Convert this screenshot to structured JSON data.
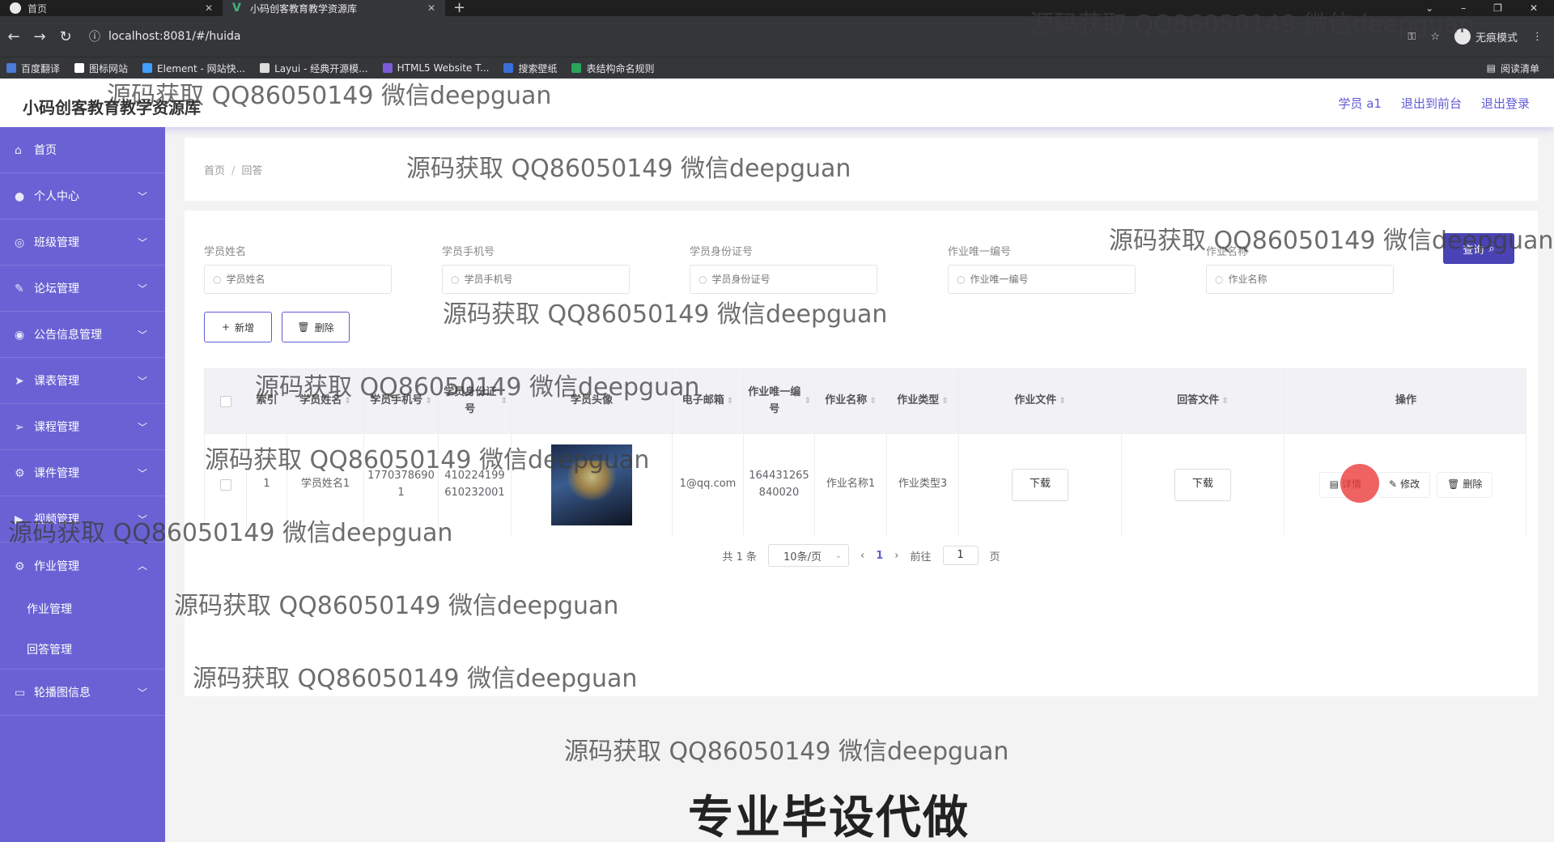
{
  "browser": {
    "tabs": [
      {
        "label": "首页",
        "active": false
      },
      {
        "label": "小码创客教育教学资源库",
        "active": true
      }
    ],
    "url": "localhost:8081/#/huida",
    "incognito_label": "无痕模式",
    "bookmarks": [
      "百度翻译",
      "图标网站",
      "Element - 网站快...",
      "Layui - 经典开源模...",
      "HTML5 Website T...",
      "搜索壁纸",
      "表结构命名规则"
    ],
    "reading_list": "阅读清单"
  },
  "header": {
    "title": "小码创客教育教学资源库",
    "user": "学员 a1",
    "back_to_front": "退出到前台",
    "logout": "退出登录"
  },
  "sidebar": {
    "items": [
      {
        "label": "首页",
        "icon": "home-icon",
        "expandable": false
      },
      {
        "label": "个人中心",
        "icon": "user-icon",
        "expandable": true
      },
      {
        "label": "班级管理",
        "icon": "class-icon",
        "expandable": true
      },
      {
        "label": "论坛管理",
        "icon": "forum-icon",
        "expandable": true
      },
      {
        "label": "公告信息管理",
        "icon": "mic-icon",
        "expandable": true
      },
      {
        "label": "课表管理",
        "icon": "send-icon",
        "expandable": true
      },
      {
        "label": "课程管理",
        "icon": "send-icon",
        "expandable": true
      },
      {
        "label": "课件管理",
        "icon": "gear-icon",
        "expandable": true
      },
      {
        "label": "视频管理",
        "icon": "video-icon",
        "expandable": true
      },
      {
        "label": "作业管理",
        "icon": "gear-icon",
        "expandable": true,
        "expanded": true
      },
      {
        "label": "轮播图信息",
        "icon": "monitor-icon",
        "expandable": true
      }
    ],
    "submenu": [
      "作业管理",
      "回答管理"
    ]
  },
  "breadcrumb": {
    "home": "首页",
    "current": "回答"
  },
  "search": {
    "fields": [
      {
        "label": "学员姓名",
        "placeholder": "学员姓名"
      },
      {
        "label": "学员手机号",
        "placeholder": "学员手机号"
      },
      {
        "label": "学员身份证号",
        "placeholder": "学员身份证号"
      },
      {
        "label": "作业唯一编号",
        "placeholder": "作业唯一编号"
      },
      {
        "label": "作业名称",
        "placeholder": "作业名称"
      }
    ],
    "query_button": "查询"
  },
  "actions": {
    "add": "新增",
    "delete": "删除"
  },
  "table": {
    "headers": [
      "索引",
      "学员姓名",
      "学员手机号",
      "学员身份证号",
      "学员头像",
      "电子邮箱",
      "作业唯一编号",
      "作业名称",
      "作业类型",
      "作业文件",
      "回答文件",
      "操作"
    ],
    "rows": [
      {
        "index": "1",
        "name": "学员姓名1",
        "phone": "17703786901",
        "idcard": "410224199610232001",
        "email": "1@qq.com",
        "homework_no": "164431265840020",
        "homework_name": "作业名称1",
        "homework_type": "作业类型3",
        "homework_file": "下载",
        "answer_file": "下载",
        "ops": {
          "detail": "详情",
          "edit": "修改",
          "delete": "删除"
        }
      }
    ]
  },
  "pagination": {
    "total": "共 1 条",
    "page_size": "10条/页",
    "current": "1",
    "goto_label": "前往",
    "goto_value": "1",
    "page_suffix": "页"
  },
  "watermark": {
    "text": "源码获取 QQ86050149 微信deepguan",
    "banner": "专业毕设代做"
  }
}
